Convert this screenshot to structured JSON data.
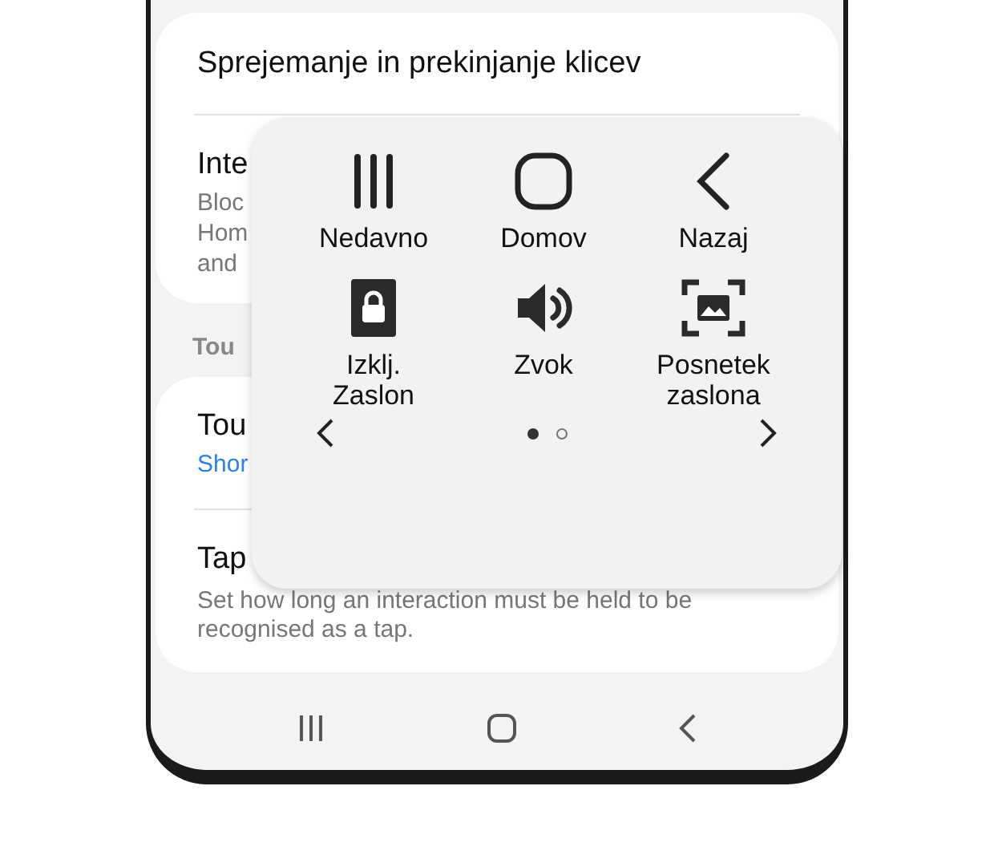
{
  "settings_card": {
    "items": [
      {
        "title": "Sprejemanje in prekinjanje klicev"
      },
      {
        "title": "Inte",
        "description_lines": [
          "Bloc",
          "Hom",
          "and"
        ]
      }
    ]
  },
  "section_header": "Tou",
  "touch_card": {
    "items": [
      {
        "title": "Tou",
        "value": "Shor"
      },
      {
        "title": "Tap",
        "description": "Set how long an interaction must be held to be recognised as a tap."
      }
    ]
  },
  "assistant_menu": {
    "items": [
      {
        "kind": "recents",
        "label": "Nedavno"
      },
      {
        "kind": "home",
        "label": "Domov"
      },
      {
        "kind": "back",
        "label": "Nazaj"
      },
      {
        "kind": "lock",
        "label": "Izklj. Zaslon"
      },
      {
        "kind": "volume",
        "label": "Zvok"
      },
      {
        "kind": "screenshot",
        "label": "Posnetek zaslona"
      }
    ],
    "page_dots": [
      {
        "selected": true
      },
      {
        "selected": false
      }
    ]
  }
}
